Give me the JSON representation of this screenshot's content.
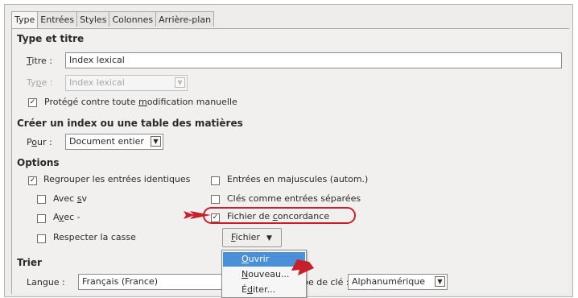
{
  "tabs": [
    "Type",
    "Entrées",
    "Styles",
    "Colonnes",
    "Arrière-plan"
  ],
  "type_title": {
    "heading": "Type et titre",
    "titre_prefix": "T",
    "titre_rest": "itre :",
    "titre_value": "Index lexical",
    "type_prefix": "Ty",
    "type_u": "p",
    "type_rest": "e :",
    "type_value": "Index lexical",
    "protect_prefix": "Protégé contre toute ",
    "protect_u": "m",
    "protect_rest": "odification manuelle"
  },
  "create": {
    "heading": "Créer un index ou une table des matières",
    "pour_prefix": "P",
    "pour_u": "o",
    "pour_rest": "ur :",
    "pour_value": "Document entier"
  },
  "options": {
    "heading": "Options",
    "regrouper": "Regrouper les entrées identiques",
    "avec_sv_prefix": "Avec ",
    "avec_sv_u": "s",
    "avec_sv_rest": "v",
    "avec_dash_prefix": "A",
    "avec_dash_u": "v",
    "avec_dash_rest": "ec -",
    "respecter": "Respecter la casse",
    "majuscules": "Entrées en majuscules (autom.)",
    "cles": "Clés comme entrées séparées",
    "concordance_prefix": "Fichier de ",
    "concordance_u": "c",
    "concordance_rest": "oncordance",
    "fichier_u": "F",
    "fichier_rest": "ichier",
    "dropdown_arrow": "▼"
  },
  "menu": {
    "ouvrir_u": "O",
    "ouvrir_rest": "uvrir",
    "nouveau_u": "N",
    "nouveau_rest": "ouveau...",
    "editer_prefix": "É",
    "editer_u": "d",
    "editer_rest": "iter..."
  },
  "trier": {
    "heading": "Trier",
    "langue_label": "Langue :",
    "langue_value": "Français (France)",
    "cle_label": "pe de clé :",
    "cle_value": "Alphanumérique"
  },
  "check_glyph": "✓",
  "colors": {
    "accent": "#4a90d9",
    "annotation_red": "#c8202a"
  }
}
